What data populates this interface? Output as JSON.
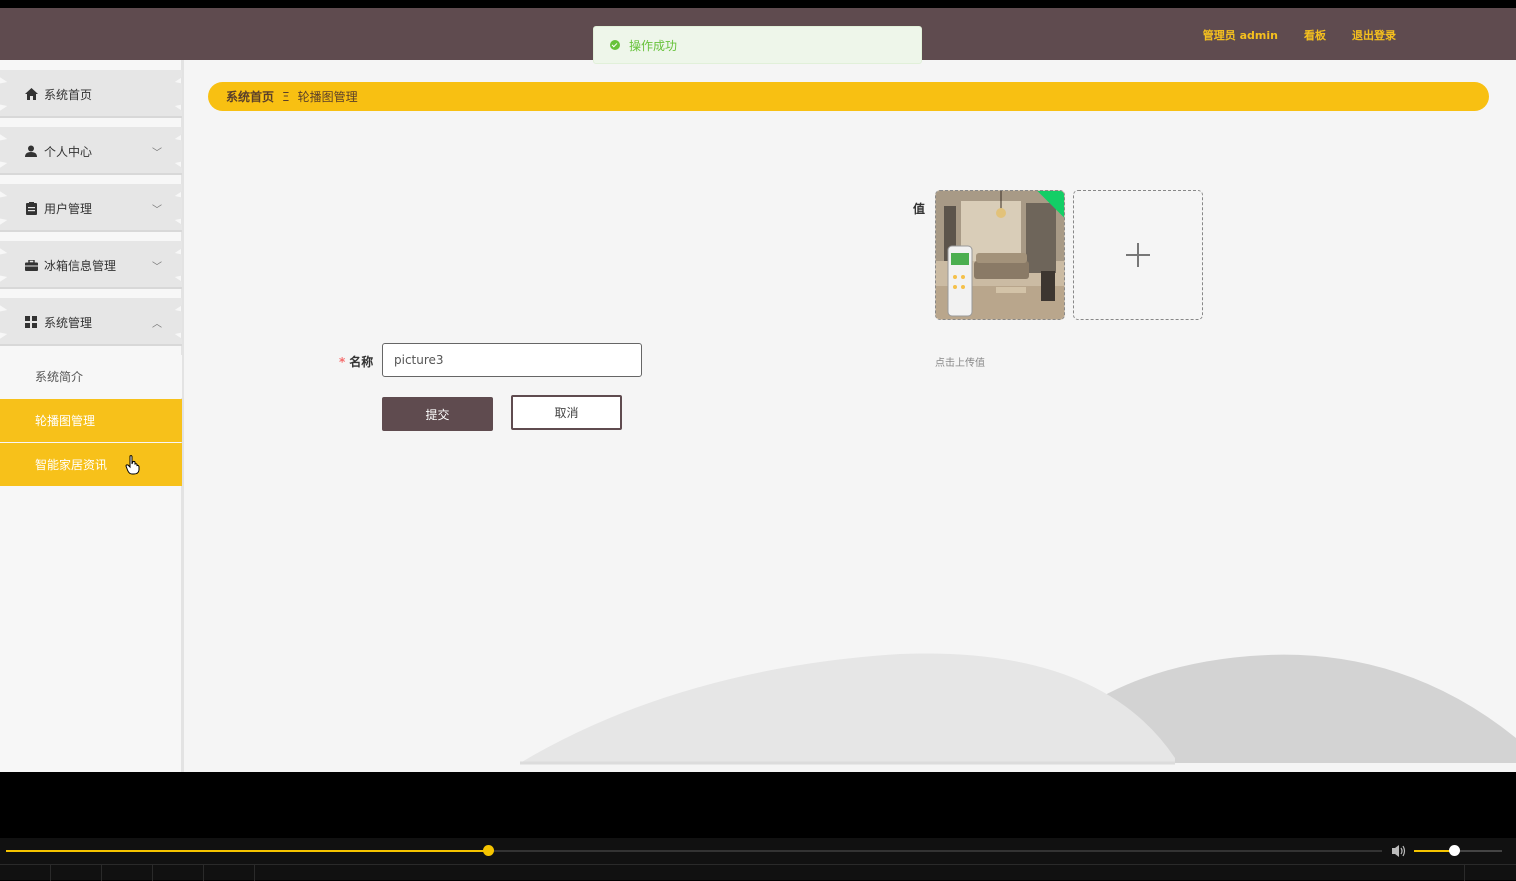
{
  "header": {
    "toast": "操作成功",
    "links": [
      "管理员 admin",
      "看板",
      "退出登录"
    ]
  },
  "sidebar": {
    "items": [
      {
        "label": "系统首页",
        "icon": "home-icon"
      },
      {
        "label": "个人中心",
        "icon": "user-icon",
        "expandable": true
      },
      {
        "label": "用户管理",
        "icon": "clipboard-icon",
        "expandable": true
      },
      {
        "label": "冰箱信息管理",
        "icon": "briefcase-icon",
        "expandable": true
      },
      {
        "label": "系统管理",
        "icon": "grid-icon",
        "expanded": true
      }
    ],
    "subitems": [
      {
        "label": "系统简介",
        "state": "normal"
      },
      {
        "label": "轮播图管理",
        "state": "active"
      },
      {
        "label": "智能家居资讯",
        "state": "hover"
      }
    ]
  },
  "breadcrumb": {
    "home": "系统首页",
    "separator": "Ξ",
    "current": "轮播图管理"
  },
  "form": {
    "value_label": "值",
    "upload_tip": "点击上传值",
    "name_label": "名称",
    "required_mark": "*",
    "name_value": "picture3",
    "submit": "提交",
    "cancel": "取消"
  },
  "player": {
    "progress": 0.35,
    "volume": 0.45
  },
  "colors": {
    "header": "#5f4b4f",
    "accent": "#f8c012",
    "success": "#67c23a"
  }
}
